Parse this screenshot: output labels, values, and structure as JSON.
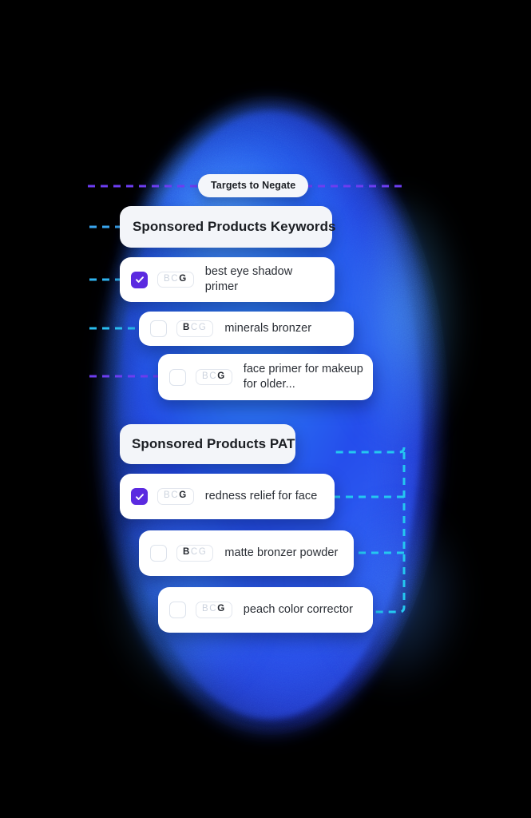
{
  "badge": {
    "label": "Targets to Negate"
  },
  "colors": {
    "checkbox_checked": "#5b2ae0",
    "dash_purple": "#6d3df0",
    "dash_cyan": "#24c8f0",
    "glow_blue": "#2a6df0",
    "card_white": "#ffffff",
    "header_gray": "#f3f5f9"
  },
  "groups": [
    {
      "header": "Sponsored Products Keywords",
      "rows": [
        {
          "checked": true,
          "match_types": [
            {
              "letter": "B",
              "active": false
            },
            {
              "letter": "C",
              "active": false
            },
            {
              "letter": "G",
              "active": true
            }
          ],
          "text": "best eye shadow primer"
        },
        {
          "checked": false,
          "match_types": [
            {
              "letter": "B",
              "active": true
            },
            {
              "letter": "C",
              "active": false
            },
            {
              "letter": "G",
              "active": false
            }
          ],
          "text": "minerals bronzer"
        },
        {
          "checked": false,
          "match_types": [
            {
              "letter": "B",
              "active": false
            },
            {
              "letter": "C",
              "active": false
            },
            {
              "letter": "G",
              "active": true
            }
          ],
          "text": "face primer for makeup for older..."
        }
      ]
    },
    {
      "header": "Sponsored Products PAT",
      "rows": [
        {
          "checked": true,
          "match_types": [
            {
              "letter": "B",
              "active": false
            },
            {
              "letter": "C",
              "active": false
            },
            {
              "letter": "G",
              "active": true
            }
          ],
          "text": "redness relief for face"
        },
        {
          "checked": false,
          "match_types": [
            {
              "letter": "B",
              "active": true
            },
            {
              "letter": "C",
              "active": false
            },
            {
              "letter": "G",
              "active": false
            }
          ],
          "text": "matte bronzer powder"
        },
        {
          "checked": false,
          "match_types": [
            {
              "letter": "B",
              "active": false
            },
            {
              "letter": "C",
              "active": false
            },
            {
              "letter": "G",
              "active": true
            }
          ],
          "text": "peach color corrector"
        }
      ]
    }
  ]
}
